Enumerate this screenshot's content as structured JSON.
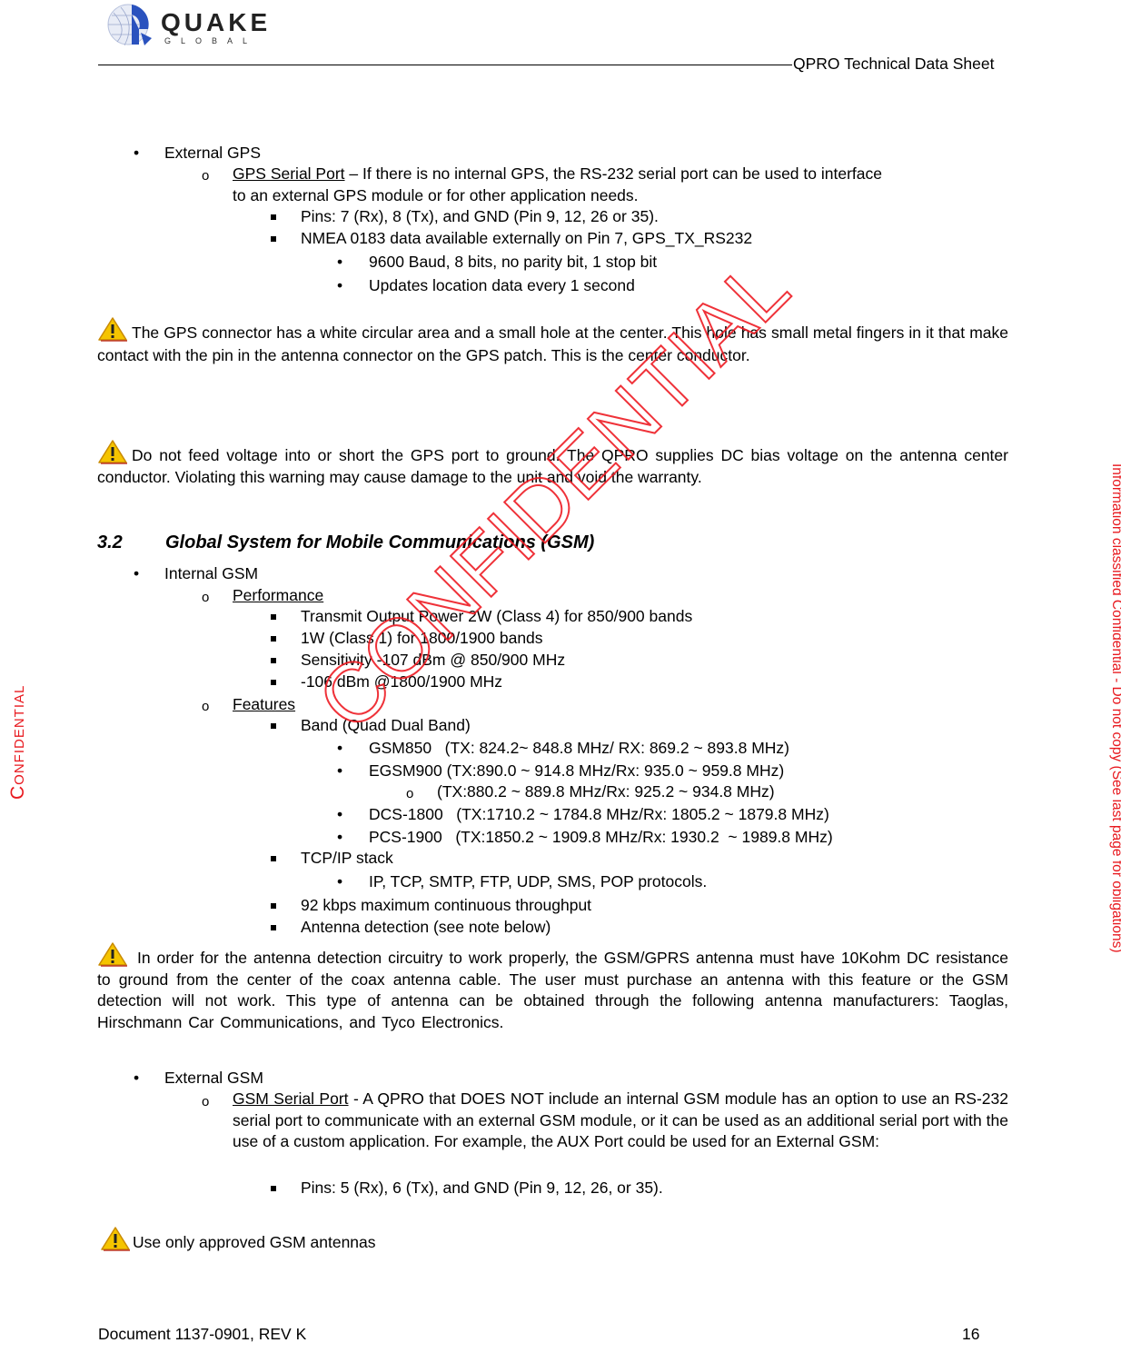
{
  "header": {
    "logo_text": "QUAKE",
    "logo_subtext": "GLOBAL",
    "doc_title": "QPRO Technical Data Sheet"
  },
  "colors": {
    "logo_blue": "#2a52be",
    "watermark_red": "#e8191f",
    "warning_yellow": "#f5c400"
  },
  "external_gps": {
    "label": "External GPS",
    "serial_port_label": "GPS Serial Port",
    "serial_port_desc_1": " – If there is no internal GPS, the RS-232 serial port can be used to interface",
    "serial_port_desc_2": "to an external GPS module or for other application needs.",
    "pins": "Pins: 7 (Rx), 8 (Tx), and GND (Pin 9, 12, 26 or 35).",
    "nmea": "NMEA 0183 data available externally on Pin 7, GPS_TX_RS232",
    "nmea_details": [
      "9600 Baud, 8 bits, no parity bit, 1 stop bit",
      "Updates location data every 1 second"
    ]
  },
  "warnings": {
    "icon": "warning-triangle-icon",
    "gps_connector": "The GPS connector has a white circular area and a small hole at the center. This hole has small metal fingers in it that make contact with the pin in the antenna connector on the GPS patch. This is the center conductor.",
    "gps_voltage": "Do not feed voltage into or short the GPS port to ground. The QPRO supplies DC bias voltage on the antenna center conductor.  Violating this warning may cause damage to the unit and void the warranty.",
    "antenna_detection": "In order for the antenna detection circuitry to work properly, the GSM/GPRS antenna must have 10Kohm DC resistance to ground from the center of the coax antenna cable.  The user must purchase an antenna with this feature or the GSM detection will not work.  This type of antenna can be obtained through the following antenna manufacturers: Taoglas, Hirschmann Car Communications, and Tyco Electronics.",
    "approved_antennas": "Use only approved GSM antennas"
  },
  "section": {
    "number": "3.2",
    "title": "Global System for Mobile Communications (GSM)"
  },
  "internal_gsm": {
    "label": "Internal GSM",
    "performance_label": "Performance",
    "performance": [
      "Transmit Output Power 2W (Class 4) for 850/900 bands",
      "1W (Class 1) for 1800/1900 bands",
      "Sensitivity -107 dBm @ 850/900 MHz",
      "-106 dBm @1800/1900 MHz"
    ],
    "features_label": "Features",
    "band_label": "Band (Quad Dual Band)",
    "bands": [
      "GSM850   (TX: 824.2~ 848.8 MHz/ RX: 869.2 ~ 893.8 MHz)",
      "EGSM900 (TX:890.0 ~ 914.8 MHz/Rx: 935.0 ~ 959.8 MHz)",
      "(TX:880.2 ~ 889.8 MHz/Rx: 925.2 ~ 934.8 MHz)",
      "DCS-1800   (TX:1710.2 ~ 1784.8 MHz/Rx: 1805.2 ~ 1879.8 MHz)",
      "PCS-1900   (TX:1850.2 ~ 1909.8 MHz/Rx: 1930.2  ~ 1989.8 MHz)"
    ],
    "tcpip_label": "TCP/IP stack",
    "tcpip_protocols": "IP, TCP, SMTP, FTP, UDP, SMS, POP protocols.",
    "throughput": "92 kbps maximum continuous throughput",
    "antenna_detection": "Antenna detection (see note below)"
  },
  "external_gsm": {
    "label": "External GSM",
    "serial_port_label": "GSM Serial Port",
    "serial_port_desc": " - A QPRO that DOES NOT include an internal GSM module has an option to use an RS-232 serial port to communicate with an external GSM module, or it can be used as an additional serial port with the use of a custom application. For example, the AUX Port could be used for an External GSM:",
    "pins": "Pins: 5 (Rx), 6 (Tx), and GND (Pin 9, 12, 26, or 35)."
  },
  "watermarks": {
    "left_side": "Confidential",
    "right_side": "Information classified Confidential - Do not copy (See last page for obligations)",
    "diagonal": "CONFIDENTIAL"
  },
  "footer": {
    "document": "Document 1137-0901, REV K",
    "page_number": "16"
  }
}
